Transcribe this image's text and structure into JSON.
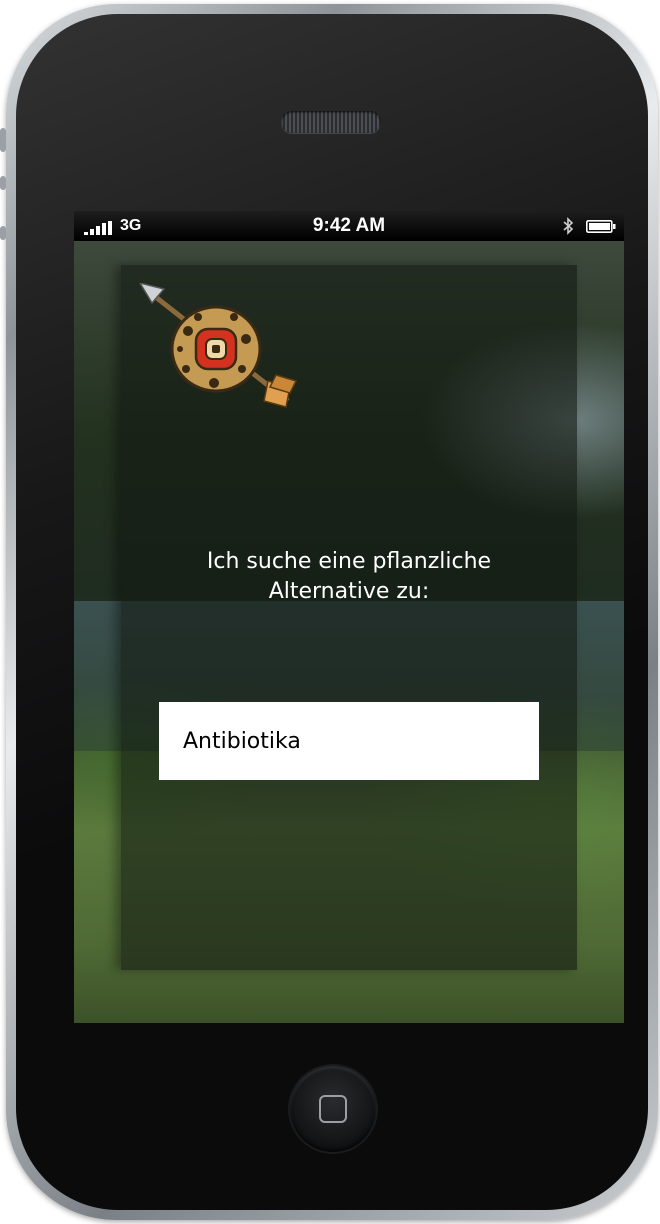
{
  "status_bar": {
    "network": "3G",
    "time": "9:42 AM",
    "signal_icon": "signal-bars-icon",
    "bluetooth_icon": "bluetooth-icon",
    "battery_icon": "battery-icon"
  },
  "app": {
    "logo_icon": "arrow-shield-logo-icon",
    "prompt_line1": "Ich suche eine pflanzliche",
    "prompt_line2": "Alternative zu:",
    "search": {
      "value": "Antibiotika"
    }
  },
  "device": {
    "home_button_icon": "home-button-icon",
    "speaker": "earpiece-speaker"
  },
  "colors": {
    "accent_red": "#d4321e",
    "panel_overlay": "#121812"
  }
}
